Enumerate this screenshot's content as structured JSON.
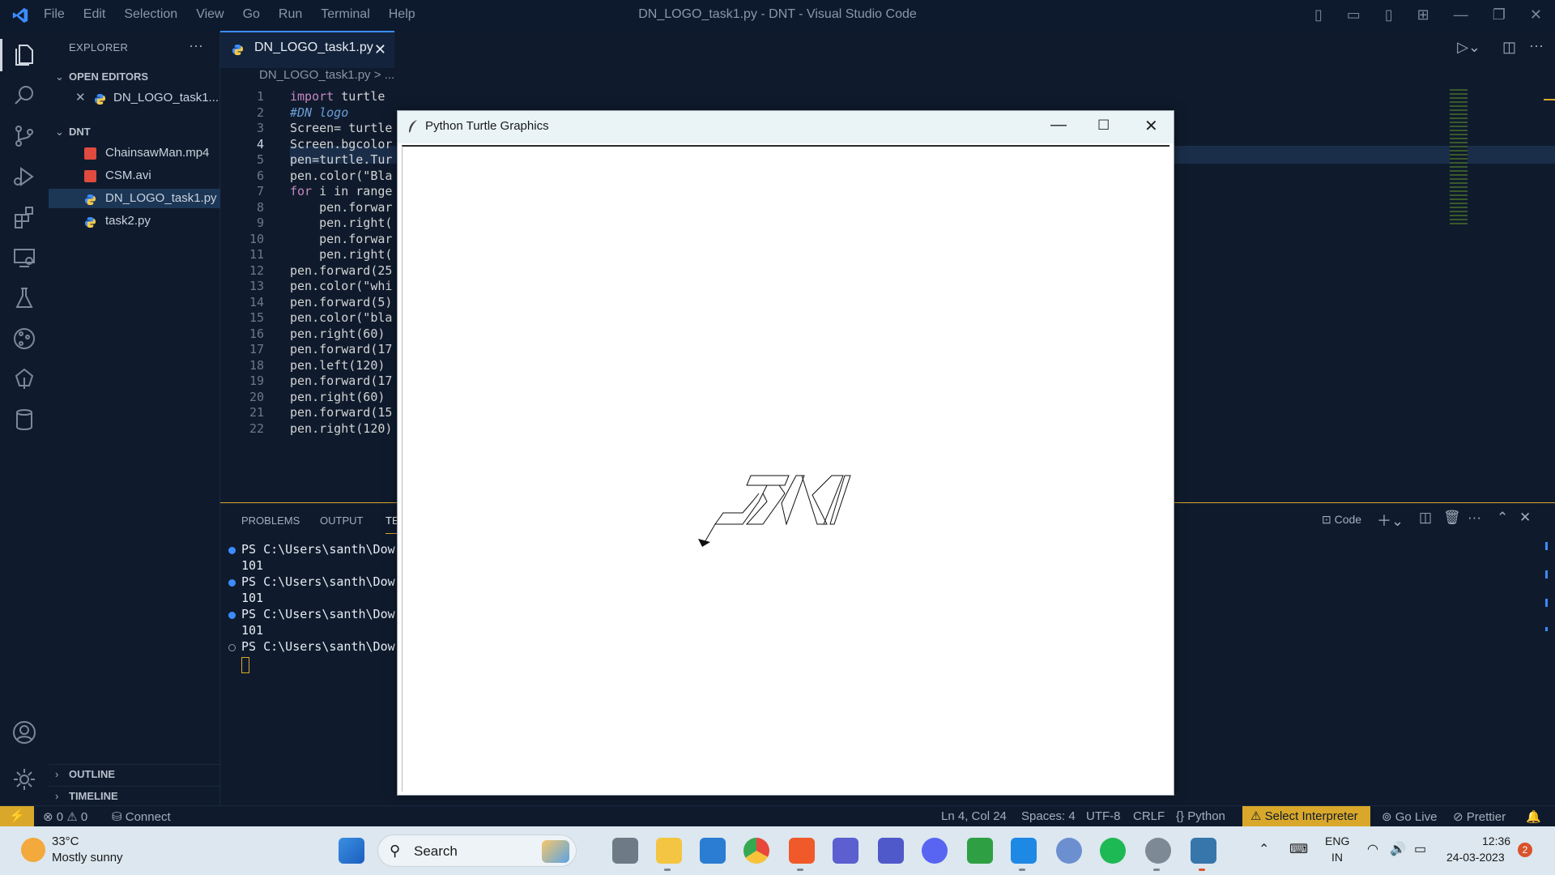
{
  "titlebar": {
    "menu": [
      "File",
      "Edit",
      "Selection",
      "View",
      "Go",
      "Run",
      "Terminal",
      "Help"
    ],
    "window_title": "DN_LOGO_task1.py - DNT - Visual Studio Code"
  },
  "sidebar": {
    "header": "EXPLORER",
    "dots": "···",
    "open_editors_label": "OPEN EDITORS",
    "open_editor_file": "DN_LOGO_task1...",
    "folder_label": "DNT",
    "files": [
      "ChainsawMan.mp4",
      "CSM.avi",
      "DN_LOGO_task1.py",
      "task2.py"
    ],
    "outline_label": "OUTLINE",
    "timeline_label": "TIMELINE"
  },
  "editor": {
    "tab_label": "DN_LOGO_task1.py",
    "breadcrumb": "DN_LOGO_task1.py > ...",
    "line_numbers": [
      "1",
      "2",
      "3",
      "4",
      "5",
      "6",
      "7",
      "8",
      "9",
      "10",
      "11",
      "12",
      "13",
      "14",
      "15",
      "16",
      "17",
      "18",
      "19",
      "20",
      "21",
      "22"
    ],
    "current_line": "4",
    "code_lines": [
      "import turtle",
      "#DN logo",
      "Screen= turtle",
      "Screen.bgcolor",
      "pen=turtle.Tur",
      "pen.color(\"Bla",
      "for i in range",
      "    pen.forwar",
      "    pen.right(",
      "    pen.forwar",
      "    pen.right(",
      "pen.forward(25",
      "pen.color(\"whi",
      "pen.forward(5)",
      "pen.color(\"bla",
      "pen.right(60)",
      "pen.forward(17",
      "pen.left(120)",
      "pen.forward(17",
      "pen.right(60)",
      "pen.forward(15",
      "pen.right(120)"
    ]
  },
  "panel": {
    "tabs": [
      "PROBLEMS",
      "OUTPUT",
      "TE"
    ],
    "terminal_label": "Code",
    "terminal_lines": [
      "PS C:\\Users\\santh\\Dow",
      "101",
      "PS C:\\Users\\santh\\Dow",
      "101",
      "PS C:\\Users\\santh\\Dow",
      "101",
      "PS C:\\Users\\santh\\Dow"
    ]
  },
  "turtle_window": {
    "title": "Python Turtle Graphics"
  },
  "statusbar": {
    "errors": "0",
    "warnings": "0",
    "connect": "Connect",
    "position": "Ln 4, Col 24",
    "spaces": "Spaces: 4",
    "encoding": "UTF-8",
    "eol": "CRLF",
    "language": "Python",
    "interpreter": "Select Interpreter",
    "golive": "Go Live",
    "prettier": "Prettier"
  },
  "taskbar": {
    "weather_temp": "33°C",
    "weather_desc": "Mostly sunny",
    "search_label": "Search",
    "lang_top": "ENG",
    "lang_bottom": "IN",
    "time": "12:36",
    "date": "24-03-2023",
    "notif_count": "2"
  },
  "colors": {
    "accent": "#3c8cff",
    "status_warning": "#d9a82a",
    "background": "#0f1b2d"
  }
}
